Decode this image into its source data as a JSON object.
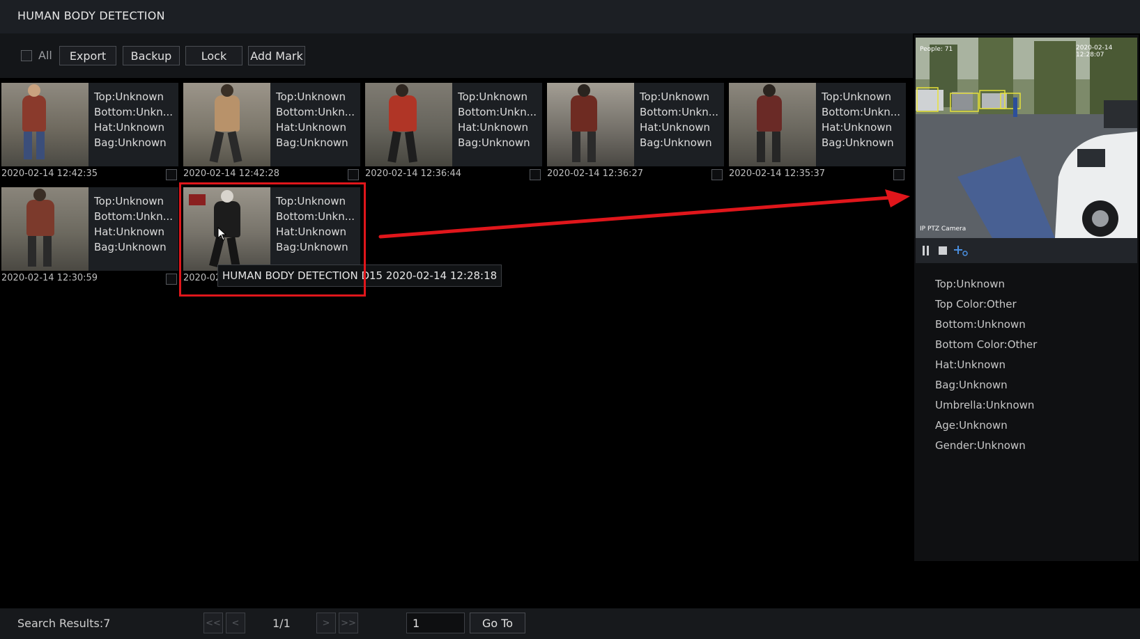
{
  "window": {
    "title": "HUMAN BODY DETECTION"
  },
  "toolbar": {
    "select_all_label": "All",
    "export_label": "Export",
    "backup_label": "Backup",
    "lock_label": "Lock",
    "add_mark_label": "Add Mark"
  },
  "results": [
    {
      "top": "Top:Unknown",
      "bottom": "Bottom:Unkn...",
      "hat": "Hat:Unknown",
      "bag": "Bag:Unknown",
      "timestamp": "2020-02-14 12:42:35"
    },
    {
      "top": "Top:Unknown",
      "bottom": "Bottom:Unkn...",
      "hat": "Hat:Unknown",
      "bag": "Bag:Unknown",
      "timestamp": "2020-02-14 12:42:28"
    },
    {
      "top": "Top:Unknown",
      "bottom": "Bottom:Unkn...",
      "hat": "Hat:Unknown",
      "bag": "Bag:Unknown",
      "timestamp": "2020-02-14 12:36:44"
    },
    {
      "top": "Top:Unknown",
      "bottom": "Bottom:Unkn...",
      "hat": "Hat:Unknown",
      "bag": "Bag:Unknown",
      "timestamp": "2020-02-14 12:36:27"
    },
    {
      "top": "Top:Unknown",
      "bottom": "Bottom:Unkn...",
      "hat": "Hat:Unknown",
      "bag": "Bag:Unknown",
      "timestamp": "2020-02-14 12:35:37"
    },
    {
      "top": "Top:Unknown",
      "bottom": "Bottom:Unkn...",
      "hat": "Hat:Unknown",
      "bag": "Bag:Unknown",
      "timestamp": "2020-02-14 12:30:59"
    },
    {
      "top": "Top:Unknown",
      "bottom": "Bottom:Unkn...",
      "hat": "Hat:Unknown",
      "bag": "Bag:Unknown",
      "timestamp": "2020-02-"
    }
  ],
  "tooltip": {
    "text": "HUMAN BODY DETECTION D15 2020-02-14 12:28:18"
  },
  "annotation": {
    "highlight_color": "#e0161b",
    "arrow_color": "#e0161b"
  },
  "preview": {
    "overlay_top_left": "People: 71",
    "overlay_top_right": "2020-02-14 12:28:07",
    "overlay_bottom_left": "IP PTZ Camera",
    "controls": [
      "pause-icon",
      "stop-icon",
      "add-tag-icon"
    ]
  },
  "attributes": [
    "Top:Unknown",
    "Top Color:Other",
    "Bottom:Unknown",
    "Bottom Color:Other",
    "Hat:Unknown",
    "Bag:Unknown",
    "Umbrella:Unknown",
    "Age:Unknown",
    "Gender:Unknown"
  ],
  "footer": {
    "search_results": "Search Results:7",
    "first_label": "<<",
    "prev_label": "<",
    "next_label": ">",
    "last_label": ">>",
    "page_info": "1/1",
    "page_input_value": "1",
    "goto_label": "Go To"
  }
}
